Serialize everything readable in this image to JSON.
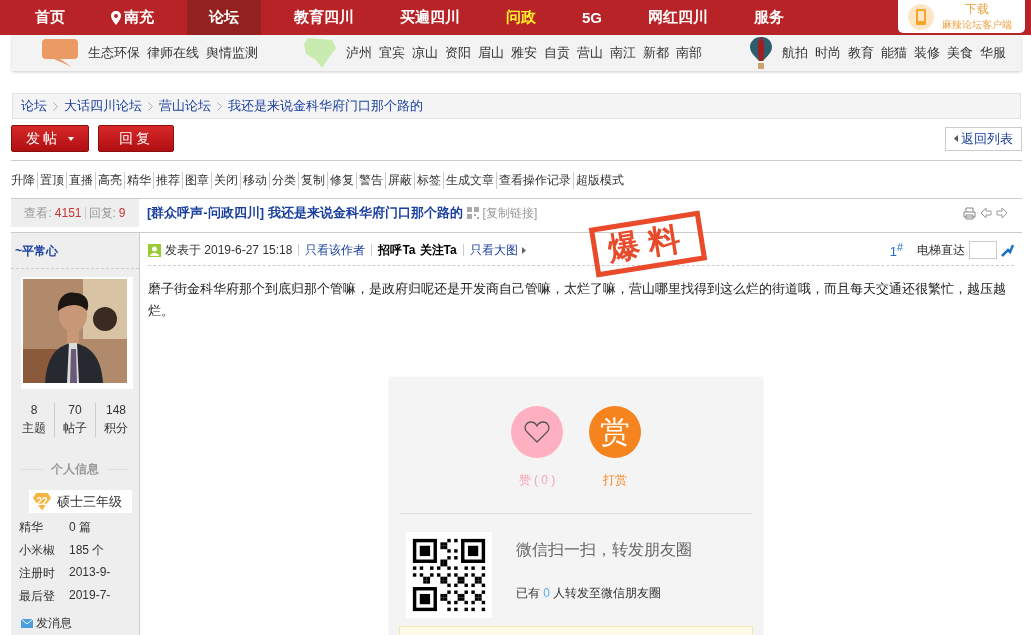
{
  "nav": {
    "items": [
      {
        "label": "首页",
        "kind": "link",
        "selected": false,
        "highlighted": false
      },
      {
        "label": "南充",
        "kind": "location",
        "selected": false,
        "highlighted": false
      },
      {
        "label": "论坛",
        "kind": "link",
        "selected": true,
        "highlighted": false
      },
      {
        "label": "教育四川",
        "kind": "link",
        "selected": false,
        "highlighted": false
      },
      {
        "label": "买遍四川",
        "kind": "link",
        "selected": false,
        "highlighted": false
      },
      {
        "label": "问政",
        "kind": "link",
        "selected": false,
        "highlighted": true
      },
      {
        "label": "5G",
        "kind": "link",
        "selected": false,
        "highlighted": false
      },
      {
        "label": "网红四川",
        "kind": "link",
        "selected": false,
        "highlighted": false
      },
      {
        "label": "服务",
        "kind": "link",
        "selected": false,
        "highlighted": false
      }
    ],
    "download": {
      "title": "下载",
      "subtitle": "麻辣论坛客户端"
    }
  },
  "subnav": {
    "groups": [
      {
        "kind": "topics",
        "links": [
          "生态环保",
          "律师在线",
          "舆情监测"
        ]
      },
      {
        "kind": "cities",
        "links": [
          "泸州",
          "宜宾",
          "凉山",
          "资阳",
          "眉山",
          "雅安",
          "自贡",
          "营山",
          "南江",
          "新都",
          "南部"
        ]
      },
      {
        "kind": "lifestyle",
        "links": [
          "航拍",
          "时尚",
          "教育",
          "能猫",
          "装修",
          "美食",
          "华服"
        ]
      }
    ]
  },
  "breadcrumb": [
    "论坛",
    "大话四川论坛",
    "营山论坛",
    "我还是来说金科华府门口那个路的"
  ],
  "toolbar": {
    "new_post": "发帖",
    "reply": "回复",
    "back": "返回列表"
  },
  "mod_actions": [
    "升降",
    "置顶",
    "直播",
    "高亮",
    "精华",
    "推荐",
    "图章",
    "关闭",
    "移动",
    "分类",
    "复制",
    "修复",
    "警告",
    "屏蔽",
    "标签",
    "生成文章",
    "查看操作记录",
    "超版模式"
  ],
  "thread": {
    "views_label": "查看:",
    "views": "4151",
    "replies_label": "回复:",
    "replies": "9",
    "title": "[群众呼声-问政四川] 我还是来说金科华府门口那个路的",
    "copy_link": "[复制链接]"
  },
  "author": {
    "name": "~平常心",
    "stats": [
      {
        "value": "8",
        "label": "主题"
      },
      {
        "value": "70",
        "label": "帖子"
      },
      {
        "value": "148",
        "label": "积分"
      }
    ],
    "info_heading": "个人信息",
    "level_number": "22",
    "level": "硕士三年级",
    "fields": [
      {
        "label": "精华",
        "value": "0 篇"
      },
      {
        "label": "小米椒",
        "value": "185 个"
      },
      {
        "label": "注册时",
        "value": "2013-9-"
      },
      {
        "label": "最后登",
        "value": "2019-7-"
      }
    ],
    "message": "发消息"
  },
  "post": {
    "posted": "发表于 2019-6-27 15:18",
    "author_only": "只看该作者",
    "greet": "招呼Ta",
    "follow": "关注Ta",
    "big_images": "只看大图",
    "floor": "1$^{#}$",
    "jump_label": "电梯直达",
    "stamp": "爆料",
    "content": "磨子街金科华府那个到底归那个管嘛，是政府归呢还是开发商自己管嘛，太烂了嘛，营山哪里找得到这么烂的街道哦，而且每天交通还很繁忙，越压越烂。"
  },
  "share": {
    "like": "赞 ( 0 )",
    "reward_icon": "赏",
    "reward": "打赏",
    "wechat_title": "微信扫一扫，转发朋友圈",
    "shared_prefix": "已有",
    "shared_count": "0",
    "shared_suffix": "人转发至微信朋友圈"
  }
}
